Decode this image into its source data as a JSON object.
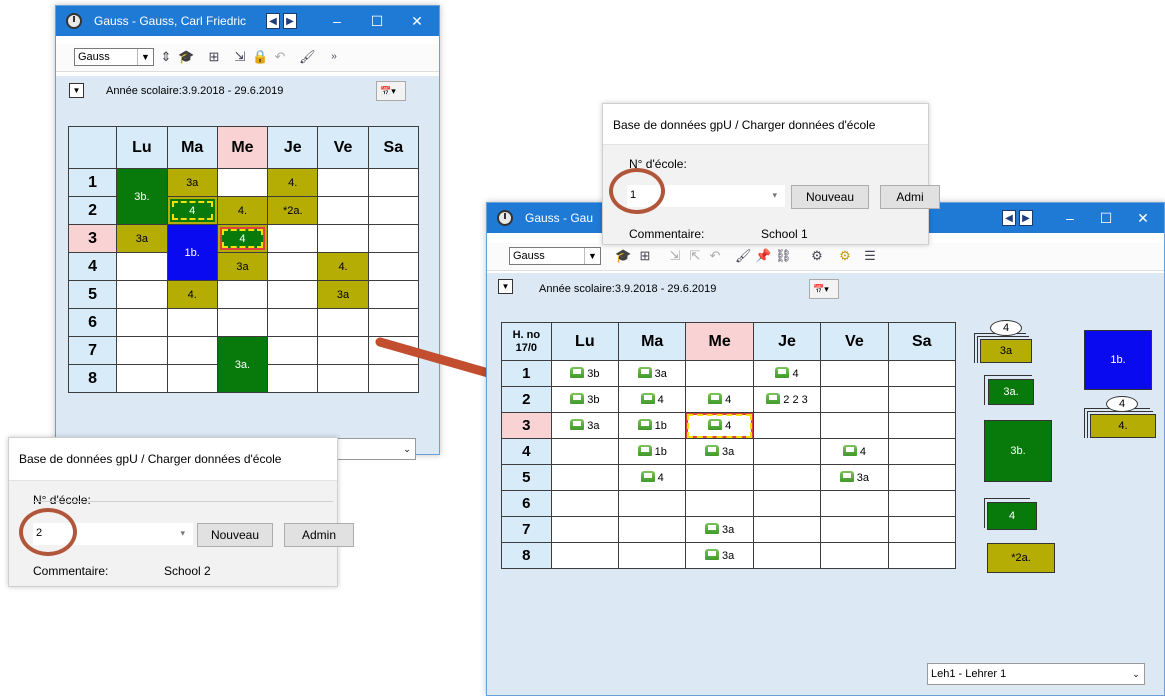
{
  "win1": {
    "title": "Gauss - Gauss, Carl Friedric",
    "combo_value": "Gauss",
    "year_label": "Année scolaire:3.9.2018 - 29.6.2019",
    "days": [
      "Lu",
      "Ma",
      "Me",
      "Je",
      "Ve",
      "Sa"
    ],
    "periods": [
      "1",
      "2",
      "3",
      "4",
      "5",
      "6",
      "7",
      "8"
    ],
    "cells": {
      "lu_1_2": "3b.",
      "lu_3": "3a",
      "ma_1": "3a",
      "ma_2": "4",
      "ma_3_4": "1b.",
      "ma_5": "4.",
      "me_2": "4.",
      "me_3": "4",
      "me_4": "3a",
      "me_7_8": "3a.",
      "je_1": "4.",
      "je_2": "*2a.",
      "ve_4": "4.",
      "ve_5": "3a"
    }
  },
  "dialog1": {
    "title": "Base de données gpU / Charger données d'école",
    "school_label": "N° d'école:",
    "school_value": "2",
    "new_button": "Nouveau",
    "admin_button": "Admin",
    "comment_label": "Commentaire:",
    "comment_value": "School 2"
  },
  "dialog2": {
    "title": "Base de données gpU / Charger données d'école",
    "school_label": "N° d'école:",
    "school_value": "1",
    "new_button": "Nouveau",
    "admin_button": "Admi",
    "comment_label": "Commentaire:",
    "comment_value": "School 1"
  },
  "win2": {
    "title": "Gauss - Gau",
    "combo_value": "Gauss",
    "year_label": "Année scolaire:3.9.2018 - 29.6.2019",
    "corner_line1": "H. no",
    "corner_line2": "17/0",
    "days": [
      "Lu",
      "Ma",
      "Me",
      "Je",
      "Ve",
      "Sa"
    ],
    "periods": [
      "1",
      "2",
      "3",
      "4",
      "5",
      "6",
      "7",
      "8"
    ],
    "cells": {
      "lu": [
        "3b",
        "3b",
        "3a",
        "",
        "",
        "",
        "",
        ""
      ],
      "ma": [
        "3a",
        "4",
        "1b",
        "1b",
        "4",
        "",
        "",
        ""
      ],
      "me": [
        "",
        "4",
        "4",
        "3a",
        "",
        "",
        "3a",
        "3a"
      ],
      "je": [
        "4",
        "2 2 3",
        "",
        "",
        "",
        "",
        "",
        ""
      ],
      "ve": [
        "",
        "",
        "",
        "4",
        "3a",
        "",
        "",
        ""
      ]
    },
    "teacher_select": "Leh1 - Lehrer 1",
    "side_chips": {
      "c1": "3a",
      "c1_badge": "4",
      "c2": "3a.",
      "c3": "3b.",
      "c4": "4",
      "c5": "*2a.",
      "c6": "1b.",
      "c7": "4.",
      "c7_badge": "4"
    }
  },
  "colors": {
    "olive": "#b6ad04",
    "green": "#077a0b",
    "blue": "#0a0af0",
    "titlebar": "#1f7ad6",
    "highlight": "#f9d3d3",
    "arrow": "#c24e2f"
  }
}
